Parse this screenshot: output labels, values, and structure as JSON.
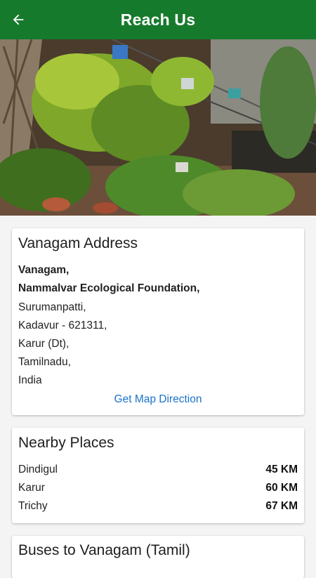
{
  "app_bar": {
    "title": "Reach Us",
    "back_icon": "arrow-left-icon",
    "color": "#167a2c"
  },
  "hero": {
    "alt": "garden photo"
  },
  "address_card": {
    "heading": "Vanagam Address",
    "lines": [
      {
        "text": "Vanagam,",
        "bold": true
      },
      {
        "text": "Nammalvar Ecological Foundation,",
        "bold": true
      },
      {
        "text": "Surumanpatti,",
        "bold": false
      },
      {
        "text": "Kadavur - 621311,",
        "bold": false
      },
      {
        "text": "Karur (Dt),",
        "bold": false
      },
      {
        "text": "Tamilnadu,",
        "bold": false
      },
      {
        "text": "India",
        "bold": false
      }
    ],
    "map_link": "Get Map Direction",
    "link_color": "#1a73c9"
  },
  "nearby_card": {
    "heading": "Nearby Places",
    "places": [
      {
        "name": "Dindigul",
        "distance": "45 KM"
      },
      {
        "name": "Karur",
        "distance": "60 KM"
      },
      {
        "name": "Trichy",
        "distance": "67 KM"
      }
    ]
  },
  "buses_card": {
    "heading": "Buses to Vanagam (Tamil)"
  }
}
